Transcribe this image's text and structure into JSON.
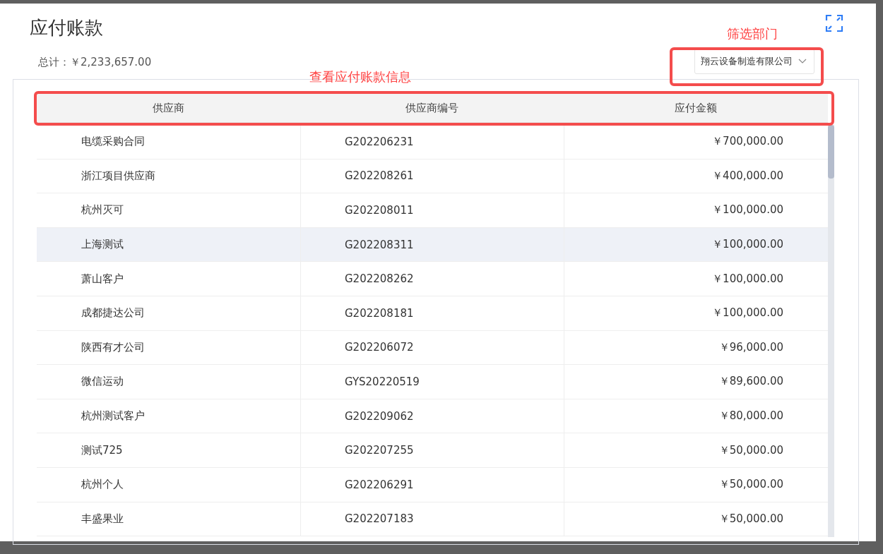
{
  "dialog": {
    "title": "应付账款",
    "total": "总计：￥2,233,657.00"
  },
  "filter": {
    "value": "翔云设备制造有限公司"
  },
  "annotations": [
    {
      "kind": "filter",
      "label": "筛选部门"
    },
    {
      "kind": "header",
      "label": "查看应付账款信息"
    }
  ],
  "table": {
    "columns": [
      "供应商",
      "供应商编号",
      "应付金额"
    ],
    "rows": [
      {
        "cells": [
          "电缆采购合同",
          "G202206231",
          "￥700,000.00"
        ],
        "highlighted": false
      },
      {
        "cells": [
          "浙江项目供应商",
          "G202208261",
          "￥400,000.00"
        ],
        "highlighted": false
      },
      {
        "cells": [
          "杭州灭可",
          "G202208011",
          "￥100,000.00"
        ],
        "highlighted": false
      },
      {
        "cells": [
          "上海测试",
          "G202208311",
          "￥100,000.00"
        ],
        "highlighted": true
      },
      {
        "cells": [
          "萧山客户",
          "G202208262",
          "￥100,000.00"
        ],
        "highlighted": false
      },
      {
        "cells": [
          "成都捷达公司",
          "G202208181",
          "￥100,000.00"
        ],
        "highlighted": false
      },
      {
        "cells": [
          "陕西有才公司",
          "G202206072",
          "￥96,000.00"
        ],
        "highlighted": false
      },
      {
        "cells": [
          "微信运动",
          "GYS20220519",
          "￥89,600.00"
        ],
        "highlighted": false
      },
      {
        "cells": [
          "杭州测试客户",
          "G202209062",
          "￥80,000.00"
        ],
        "highlighted": false
      },
      {
        "cells": [
          "测试725",
          "G202207255",
          "￥50,000.00"
        ],
        "highlighted": false
      },
      {
        "cells": [
          "杭州个人",
          "G202206291",
          "￥50,000.00"
        ],
        "highlighted": false
      },
      {
        "cells": [
          "丰盛果业",
          "G202207183",
          "￥50,000.00"
        ],
        "highlighted": false
      }
    ]
  }
}
